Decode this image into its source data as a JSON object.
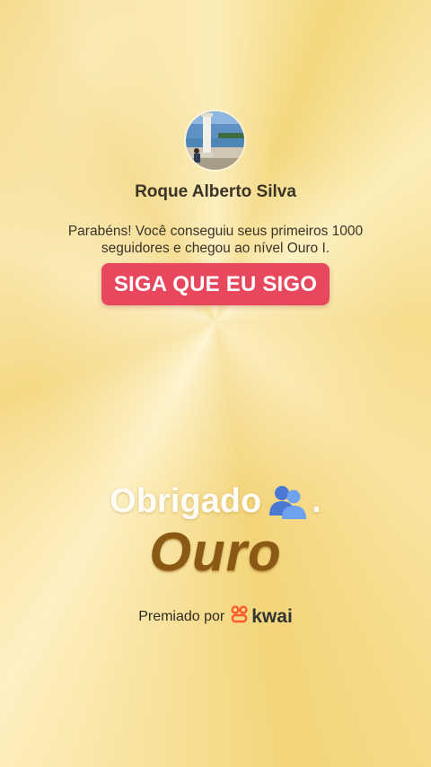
{
  "profile": {
    "name": "Roque Alberto Silva",
    "avatar_icon": "avatar-photo"
  },
  "message": {
    "line1": "Parabéns! Você conseguiu seus primeiros 1000",
    "line2": "seguidores e chegou ao nível Ouro I."
  },
  "follow_button": {
    "label": "SIGA QUE EU SIGO",
    "color": "#e8485e"
  },
  "thanks": {
    "text": "Obrigado",
    "emoji_icon": "users-icon",
    "suffix": "."
  },
  "level": {
    "text": "Ouro"
  },
  "footer": {
    "awarded_by": "Premiado por",
    "brand": "kwai",
    "brand_icon": "kwai-logo-icon",
    "brand_color": "#ff5a2c"
  },
  "colors": {
    "background": "#f6dc8c",
    "level_text": "#8a5a14"
  }
}
